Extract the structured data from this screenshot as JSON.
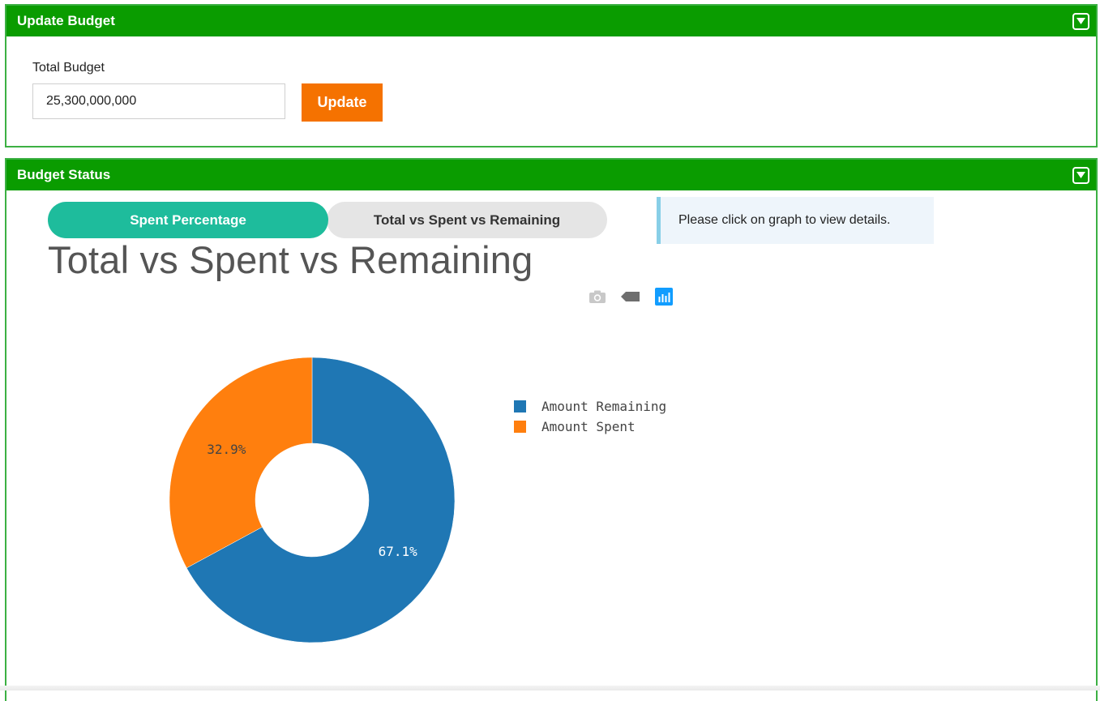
{
  "update_budget": {
    "title": "Update Budget",
    "total_budget_label": "Total Budget",
    "total_budget_value": "25,300,000,000",
    "update_button": "Update"
  },
  "budget_status": {
    "title": "Budget Status",
    "tabs": [
      {
        "label": "Spent Percentage",
        "active": true
      },
      {
        "label": "Total vs Spent vs Remaining",
        "active": false
      }
    ],
    "info_message": "Please click on graph to view details.",
    "chart_heading": "Total vs Spent vs Remaining",
    "modebar_icons": [
      "camera-icon",
      "tag-icon",
      "plotly-logo-icon"
    ]
  },
  "colors": {
    "header_green": "#0a9c00",
    "border_green": "#3cb043",
    "update_orange": "#f57200",
    "tab_active": "#1ebc9c",
    "remaining_blue": "#1f77b4",
    "spent_orange": "#ff7f0e"
  },
  "chart_data": {
    "type": "pie",
    "hole": true,
    "labels": [
      "Amount Remaining",
      "Amount Spent"
    ],
    "values": [
      67.1,
      32.9
    ],
    "text": [
      "67.1%",
      "32.9%"
    ],
    "colors": [
      "#1f77b4",
      "#ff7f0e"
    ],
    "legend_placement": "right"
  }
}
